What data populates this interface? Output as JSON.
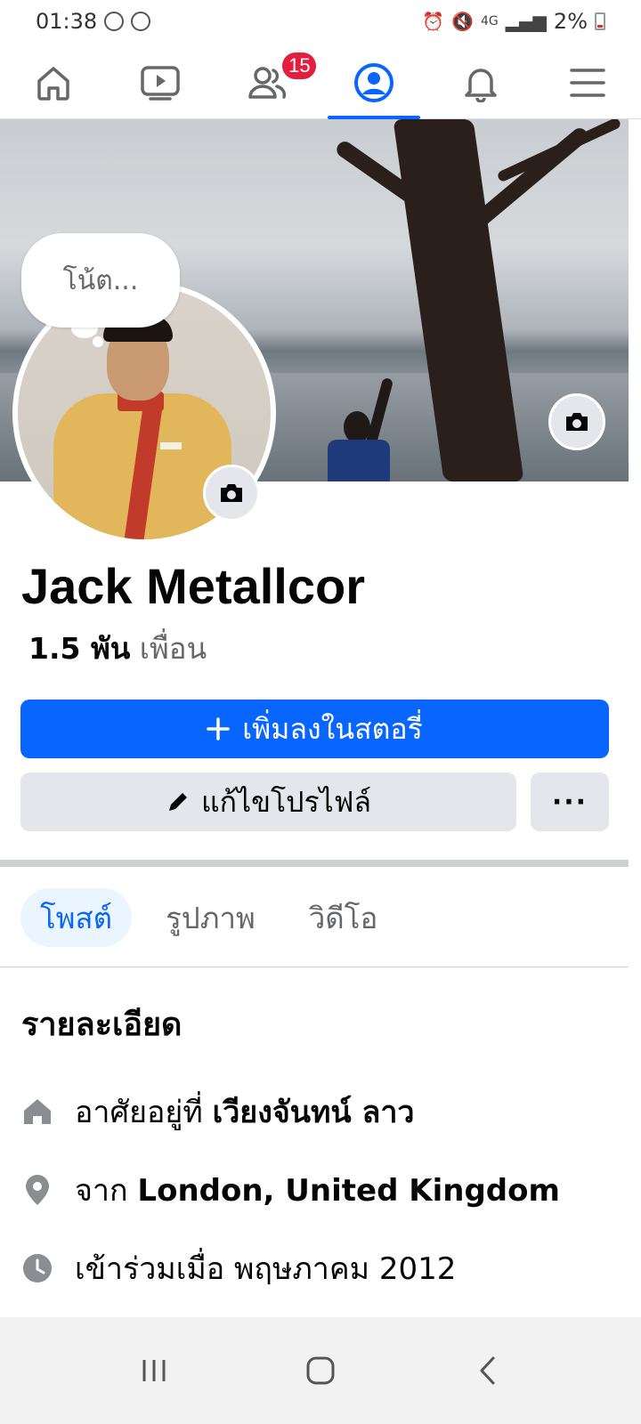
{
  "status_bar": {
    "time": "01:38",
    "battery": "2%",
    "network": "4G"
  },
  "top_nav": {
    "items": [
      {
        "name": "home",
        "icon": "home-icon"
      },
      {
        "name": "video",
        "icon": "video-icon"
      },
      {
        "name": "friends",
        "icon": "friends-icon",
        "badge": "15"
      },
      {
        "name": "profile",
        "icon": "profile-icon",
        "active": true
      },
      {
        "name": "notifications",
        "icon": "bell-icon"
      },
      {
        "name": "menu",
        "icon": "menu-icon"
      }
    ]
  },
  "profile": {
    "note": "โน้ต...",
    "name": "Jack Metallcor",
    "friends_count": "1.5 พัน",
    "friends_label": "เพื่อน"
  },
  "actions": {
    "add_story": "เพิ่มลงในสตอรี่",
    "edit_profile": "แก้ไขโปรไฟล์",
    "more": "···"
  },
  "tabs": [
    {
      "label": "โพสต์",
      "active": true
    },
    {
      "label": "รูปภาพ",
      "active": false
    },
    {
      "label": "วิดีโอ",
      "active": false
    }
  ],
  "details": {
    "title": "รายละเอียด",
    "lives_prefix": "อาศัยอยู่ที่",
    "lives_value": "เวียงจันทน์ ลาว",
    "from_prefix": "จาก",
    "from_value": "London, United Kingdom",
    "joined": "เข้าร่วมเมื่อ พฤษภาคม 2012"
  },
  "colors": {
    "accent": "#0866ff",
    "badge": "#e41e3f",
    "button_gray": "#e4e6eb",
    "tab_active_bg": "#ebf5ff"
  }
}
